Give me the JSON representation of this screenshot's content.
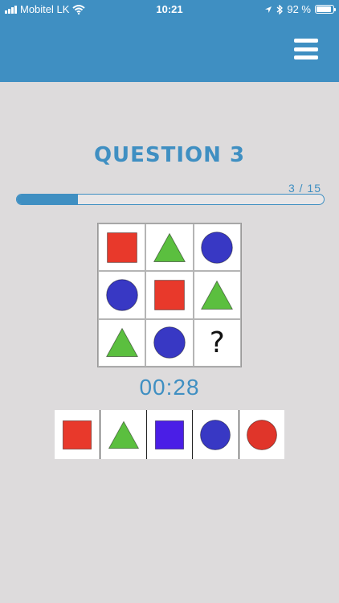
{
  "status_bar": {
    "carrier": "Mobitel LK",
    "time": "10:21",
    "battery_percent": "92 %"
  },
  "header": {
    "menu_icon": "hamburger-menu-icon"
  },
  "quiz": {
    "title": "QUESTION 3",
    "progress_text": "3 / 15",
    "progress_fraction": 0.2,
    "timer": "00:28",
    "grid": [
      {
        "shape": "square",
        "color": "#e8392b"
      },
      {
        "shape": "triangle",
        "color": "#5bbf3f"
      },
      {
        "shape": "circle",
        "color": "#3838c4"
      },
      {
        "shape": "circle",
        "color": "#3838c4"
      },
      {
        "shape": "square",
        "color": "#e8392b"
      },
      {
        "shape": "triangle",
        "color": "#5bbf3f"
      },
      {
        "shape": "triangle",
        "color": "#5bbf3f"
      },
      {
        "shape": "circle",
        "color": "#3838c4"
      },
      {
        "shape": "unknown",
        "label": "?"
      }
    ],
    "options": [
      {
        "shape": "square",
        "color": "#e8392b"
      },
      {
        "shape": "triangle",
        "color": "#5bbf3f"
      },
      {
        "shape": "square",
        "color": "#4a1ee6"
      },
      {
        "shape": "circle",
        "color": "#3838c4"
      },
      {
        "shape": "circle",
        "color": "#e0352a"
      }
    ]
  },
  "colors": {
    "accent": "#3f8fc2",
    "background": "#dddbdc"
  }
}
